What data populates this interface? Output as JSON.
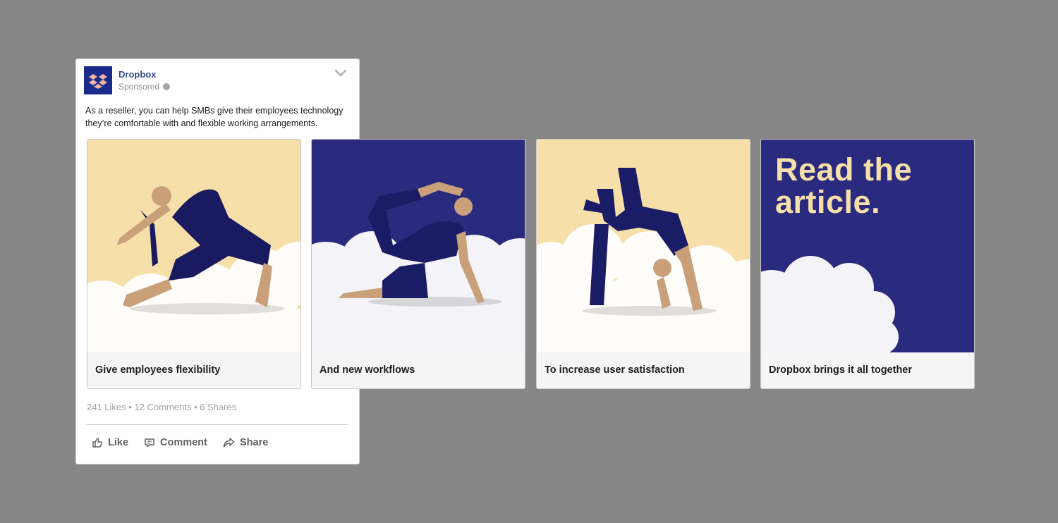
{
  "post": {
    "page_name": "Dropbox",
    "sponsored": "Sponsored",
    "text": "As a reseller, you can help SMBs give their employees technology they’re comfortable with and flexible working arrangements.",
    "stats": "241 Likes • 12 Comments • 6 Shares",
    "actions": {
      "like": "Like",
      "comment": "Comment",
      "share": "Share"
    }
  },
  "cards": [
    {
      "label": "Give employees flexibility",
      "background": "#f7dfa9"
    },
    {
      "label": "And new workflows",
      "background": "#2a2b7e"
    },
    {
      "label": "To increase user satisfaction",
      "background": "#f7dfa9"
    },
    {
      "label": "Dropbox brings it all together",
      "background": "#2a2b7e",
      "headline": "Read the article."
    }
  ],
  "colors": {
    "brand": "#1a2b8c",
    "cream": "#f7dfa9",
    "navy": "#2a2b7e",
    "page_bg": "#868686"
  }
}
